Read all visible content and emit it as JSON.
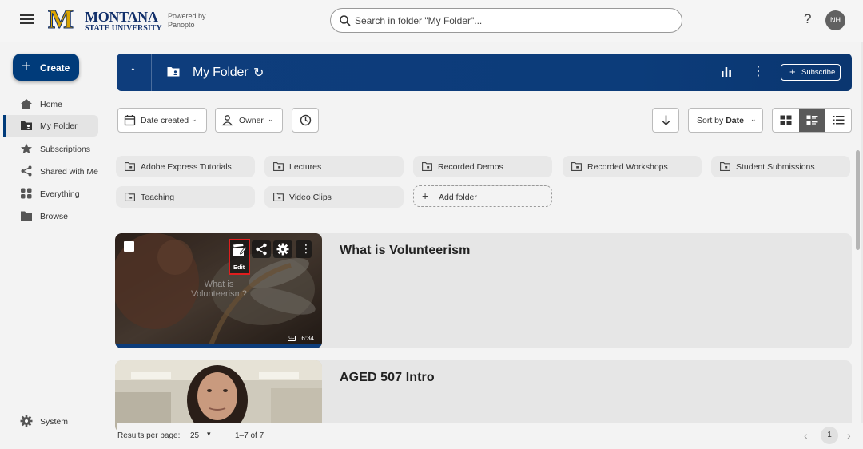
{
  "brand": {
    "logo_mark": "M",
    "logo_line1": "MONTANA",
    "logo_line2": "STATE UNIVERSITY",
    "powered_line1": "Powered by",
    "powered_line2": "Panopto"
  },
  "search": {
    "placeholder": "Search in folder \"My Folder\"...",
    "icon": "search-icon"
  },
  "header": {
    "help": "?",
    "avatar_initials": "NH"
  },
  "sidebar": {
    "create_label": "Create",
    "items": [
      {
        "label": "Home",
        "icon": "home-icon"
      },
      {
        "label": "My Folder",
        "icon": "folder-user-icon",
        "active": true
      },
      {
        "label": "Subscriptions",
        "icon": "star-icon"
      },
      {
        "label": "Shared with Me",
        "icon": "share-icon"
      },
      {
        "label": "Everything",
        "icon": "grid-icon"
      },
      {
        "label": "Browse",
        "icon": "folder-icon"
      }
    ],
    "system_label": "System"
  },
  "folder": {
    "title": "My Folder",
    "subscribe_label": "Subscribe"
  },
  "filters": {
    "date_label": "Date created",
    "owner_label": "Owner",
    "sort_prefix": "Sort by ",
    "sort_value": "Date",
    "view_mode": "detailed-list"
  },
  "subfolders": [
    "Adobe Express Tutorials",
    "Lectures",
    "Recorded Demos",
    "Recorded Workshops",
    "Student Submissions",
    "Teaching",
    "Video Clips"
  ],
  "add_folder_label": "Add folder",
  "sessions": [
    {
      "title": "What is Volunteerism",
      "thumb_text_1": "What is",
      "thumb_text_2": "Volunteerism?",
      "duration": "6:34",
      "edit_label": "Edit",
      "cc": "CC"
    },
    {
      "title": "AGED 507 Intro"
    }
  ],
  "footer": {
    "results_per_page_label": "Results per page:",
    "results_per_page_value": "25",
    "range": "1–7 of 7",
    "current_page": "1"
  },
  "colors": {
    "primary": "#003b7a",
    "highlight": "#e01e1e",
    "logo_gold": "#d9a400"
  }
}
